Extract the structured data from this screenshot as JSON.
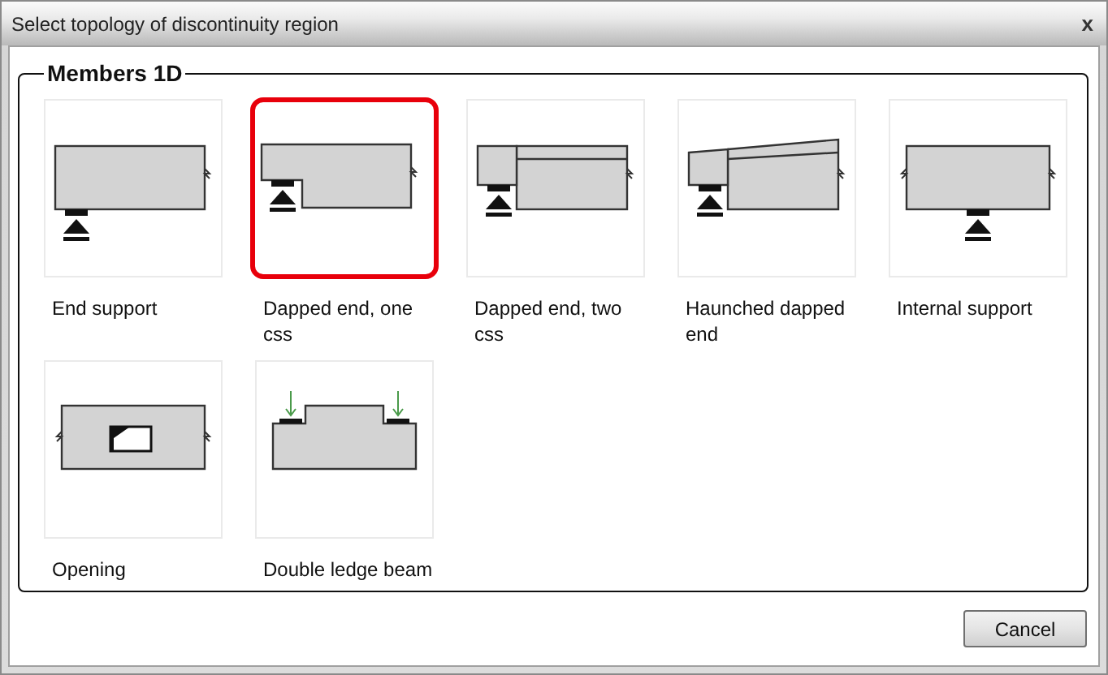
{
  "window": {
    "title": "Select topology of discontinuity region",
    "close": "x"
  },
  "group": {
    "title": "Members 1D",
    "items": [
      {
        "kind": "end",
        "label": "End support",
        "selected": false
      },
      {
        "kind": "dapped",
        "label": "Dapped end, one css",
        "selected": true
      },
      {
        "kind": "dapped2",
        "label": "Dapped end, two css",
        "selected": false
      },
      {
        "kind": "haunched",
        "label": "Haunched dapped end",
        "selected": false
      },
      {
        "kind": "internal",
        "label": "Internal support",
        "selected": false
      },
      {
        "kind": "opening",
        "label": "Opening",
        "selected": false
      },
      {
        "kind": "ledge",
        "label": "Double ledge beam",
        "selected": false
      }
    ]
  },
  "buttons": [
    "Cancel"
  ]
}
